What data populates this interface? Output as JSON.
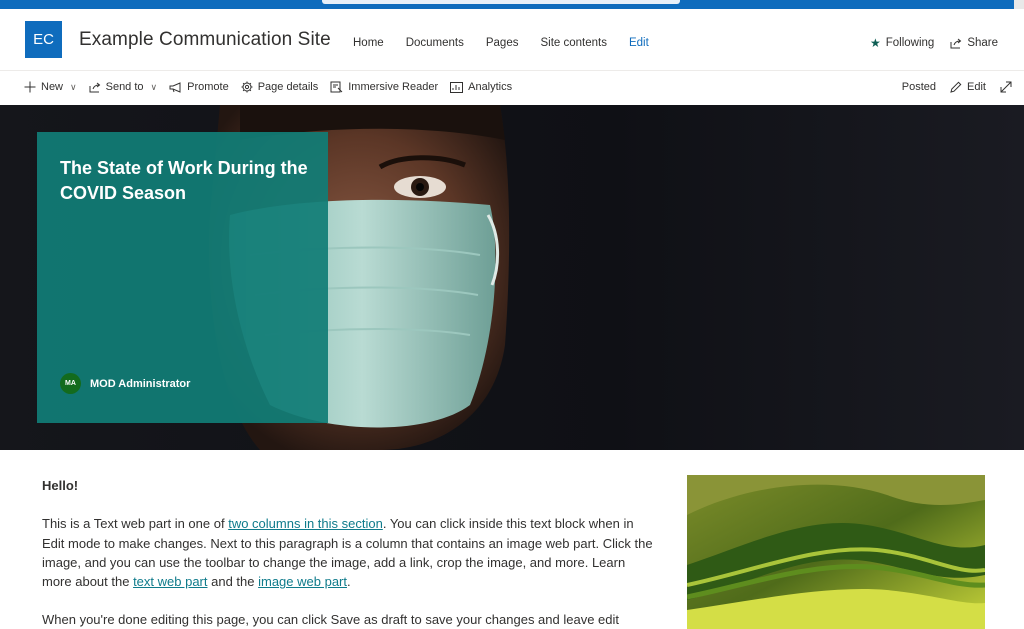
{
  "site": {
    "logo_initials": "EC",
    "title": "Example Communication Site",
    "nav": [
      "Home",
      "Documents",
      "Pages",
      "Site contents",
      "Edit"
    ],
    "following": "Following",
    "share": "Share"
  },
  "commandbar": {
    "new": "New",
    "send_to": "Send to",
    "promote": "Promote",
    "page_details": "Page details",
    "immersive_reader": "Immersive Reader",
    "analytics": "Analytics",
    "status": "Posted",
    "edit": "Edit"
  },
  "hero": {
    "title": "The State of Work During the COVID Season",
    "author_initials": "MA",
    "author_name": "MOD Administrator"
  },
  "content": {
    "hello": "Hello!",
    "p1_a": "This is a Text web part in one of ",
    "p1_link1": "two columns in this section",
    "p1_b": ". You can click inside this text block when in Edit mode to make changes. Next to this paragraph is a column that contains an image web part. Click the image, and you can use the toolbar to change the image, add a link, crop the image, and more. Learn more about the ",
    "p1_link2": "text web part",
    "p1_c": " and the ",
    "p1_link3": "image web part",
    "p1_d": ".",
    "p2": "When you're done editing this page, you can click Save as draft to save your changes and leave edit"
  },
  "colors": {
    "brand": "#0f6cbd",
    "hero_card": "#117d76",
    "link": "#0f7b8b"
  }
}
